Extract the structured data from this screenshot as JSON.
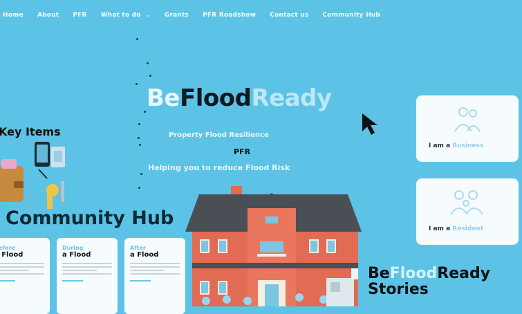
{
  "nav": {
    "items": [
      "Home",
      "About",
      "PFR",
      "What to do",
      "Grants",
      "PFR Roadshow",
      "Contact us",
      "Community Hub"
    ]
  },
  "hero": {
    "title_part1": "Be",
    "title_part2": "Flood",
    "title_part3": "Ready",
    "subtitle_line1": "Property Flood Resilience",
    "subtitle_line2": "PFR",
    "subtitle_line3": "Helping you to reduce Flood Risk"
  },
  "key_items": {
    "title": "Key Items"
  },
  "community_hub": {
    "title": "Community Hub",
    "cards": [
      {
        "kicker": "Before",
        "heading": "a Flood"
      },
      {
        "kicker": "During",
        "heading": "a Flood"
      },
      {
        "kicker": "After",
        "heading": "a Flood"
      }
    ]
  },
  "side_cards": [
    {
      "prefix": "I am a",
      "role": "Business"
    },
    {
      "prefix": "I am a",
      "role": "Resident"
    }
  ],
  "stories": {
    "part1": "Be",
    "part2": "Flood",
    "part3": "Ready",
    "line2": "Stories"
  },
  "colors": {
    "background": "#5cc3e6",
    "brick": "#e26b53",
    "roof": "#4a4f55",
    "dark_text": "#111820"
  }
}
